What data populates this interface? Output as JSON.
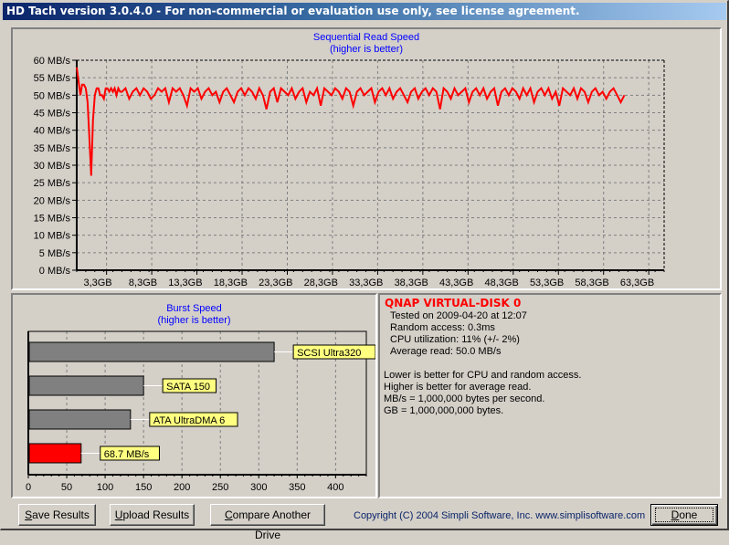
{
  "window": {
    "title": "HD Tach version 3.0.4.0  - For non-commercial or evaluation use only, see license agreement."
  },
  "sequential_chart": {
    "title_line1": "Sequential Read Speed",
    "title_line2": "(higher is better)"
  },
  "burst_chart": {
    "title_line1": "Burst Speed",
    "title_line2": "(higher is better)"
  },
  "info": {
    "drive_name": "QNAP VIRTUAL-DISK 0",
    "tested_on": "Tested on 2009-04-20 at 12:07",
    "random_access": "Random access: 0.3ms",
    "cpu_utilization": "CPU utilization: 11% (+/- 2%)",
    "average_read": "Average read: 50.0 MB/s",
    "notes": [
      "Lower is better for CPU and random access.",
      "Higher is better for average read.",
      "MB/s = 1,000,000 bytes per second.",
      "GB = 1,000,000,000 bytes."
    ]
  },
  "buttons": {
    "save_results": {
      "accel": "S",
      "rest": "ave Results"
    },
    "upload_results": {
      "accel": "U",
      "rest": "pload Results"
    },
    "compare_drive": {
      "accel": "C",
      "rest": "ompare Another Drive"
    },
    "done": {
      "accel": "D",
      "rest": "one"
    }
  },
  "footer": {
    "copyright": "Copyright (C) 2004 Simpli Software, Inc. www.simplisoftware.com"
  },
  "colors": {
    "line": "#ff0000",
    "reference_bar": "#808080",
    "tested_bar": "#ff0000",
    "label_bg": "#ffff80",
    "title_blue": "#0000ff"
  },
  "chart_data": [
    {
      "type": "line",
      "title": "Sequential Read Speed (higher is better)",
      "xlabel": "",
      "ylabel": "",
      "ylim": [
        0,
        60
      ],
      "xlim": [
        0,
        65
      ],
      "y_ticks": [
        "0 MB/s",
        "5 MB/s",
        "10 MB/s",
        "15 MB/s",
        "20 MB/s",
        "25 MB/s",
        "30 MB/s",
        "35 MB/s",
        "40 MB/s",
        "45 MB/s",
        "50 MB/s",
        "55 MB/s",
        "60 MB/s"
      ],
      "x_ticks": [
        "3,3GB",
        "8,3GB",
        "13,3GB",
        "18,3GB",
        "23,3GB",
        "28,3GB",
        "33,3GB",
        "38,3GB",
        "43,3GB",
        "48,3GB",
        "53,3GB",
        "58,3GB",
        "63,3GB"
      ],
      "x_tick_values": [
        3.3,
        8.3,
        13.3,
        18.3,
        23.3,
        28.3,
        33.3,
        38.3,
        43.3,
        48.3,
        53.3,
        58.3,
        63.3
      ],
      "grid": true,
      "series": [
        {
          "name": "Read speed",
          "x": [
            0,
            0.2,
            0.4,
            0.6,
            0.8,
            1.0,
            1.2,
            1.4,
            1.6,
            1.8,
            2.0,
            2.2,
            2.4,
            2.6,
            2.8,
            3.0,
            3.2,
            3.4,
            3.6,
            3.8,
            4.0,
            4.2,
            4.4,
            4.6,
            4.8,
            5.0,
            5.4,
            5.8,
            6.2,
            6.6,
            7.0,
            7.4,
            7.8,
            8.2,
            8.6,
            9.0,
            9.4,
            9.8,
            10.2,
            10.6,
            11.0,
            11.4,
            11.8,
            12.2,
            12.6,
            13.0,
            13.4,
            13.8,
            14.2,
            14.6,
            15.0,
            15.4,
            15.8,
            16.2,
            16.6,
            17.0,
            17.4,
            17.8,
            18.2,
            18.6,
            19.0,
            19.4,
            19.8,
            20.2,
            20.6,
            21.0,
            21.4,
            21.8,
            22.2,
            22.6,
            23.0,
            23.4,
            23.8,
            24.2,
            24.6,
            25.0,
            25.4,
            25.8,
            26.2,
            26.6,
            27.0,
            27.4,
            27.8,
            28.2,
            28.6,
            29.0,
            29.4,
            29.8,
            30.2,
            30.6,
            31.0,
            31.4,
            31.8,
            32.2,
            32.6,
            33.0,
            33.4,
            33.8,
            34.2,
            34.6,
            35.0,
            35.4,
            35.8,
            36.2,
            36.6,
            37.0,
            37.4,
            37.8,
            38.2,
            38.6,
            39.0,
            39.4,
            39.8,
            40.2,
            40.6,
            41.0,
            41.4,
            41.8,
            42.2,
            42.6,
            43.0,
            43.4,
            43.8,
            44.2,
            44.6,
            45.0,
            45.4,
            45.8,
            46.2,
            46.6,
            47.0,
            47.4,
            47.8,
            48.2,
            48.6,
            49.0,
            49.4,
            49.8,
            50.2,
            50.6,
            51.0,
            51.4,
            51.8,
            52.2,
            52.6,
            53.0,
            53.4,
            53.8,
            54.2,
            54.6,
            55.0,
            55.4,
            55.8,
            56.2,
            56.6,
            57.0,
            57.4,
            57.8,
            58.2,
            58.6,
            59.0,
            59.4,
            59.8,
            60.2,
            60.6,
            61.0,
            61.4,
            61.8,
            62.2,
            62.6,
            63.0,
            63.4,
            63.8,
            64.2,
            64.6,
            65.0
          ],
          "y": [
            58,
            54,
            50,
            53,
            53,
            52,
            48,
            38,
            27,
            43,
            50,
            52,
            52,
            50,
            50,
            49,
            52,
            52,
            51,
            52,
            51,
            52,
            50,
            52,
            51,
            51,
            52,
            49,
            51,
            52,
            50,
            52,
            51,
            49,
            50,
            52,
            51,
            52,
            48,
            52,
            51,
            52,
            50,
            47,
            52,
            51,
            52,
            49,
            51,
            52,
            50,
            51,
            48,
            51,
            52,
            50,
            48,
            51,
            52,
            50,
            52,
            51,
            49,
            52,
            50,
            46,
            51,
            52,
            48,
            52,
            51,
            50,
            52,
            49,
            51,
            52,
            48,
            51,
            50,
            52,
            47,
            52,
            51,
            50,
            52,
            51,
            49,
            52,
            51,
            47,
            51,
            52,
            50,
            51,
            52,
            48,
            51,
            52,
            50,
            52,
            49,
            51,
            52,
            50,
            48,
            51,
            52,
            49,
            51,
            52,
            50,
            52,
            51,
            46,
            52,
            51,
            49,
            52,
            50,
            51,
            52,
            48,
            51,
            52,
            50,
            52,
            49,
            51,
            52,
            47,
            51,
            52,
            50,
            52,
            51,
            49,
            52,
            50,
            52,
            48,
            51,
            52,
            50,
            52,
            49,
            51,
            47,
            52,
            51,
            50,
            52,
            49,
            52,
            51,
            48,
            51,
            52,
            50,
            51,
            49,
            51,
            52,
            50,
            48,
            50
          ]
        }
      ]
    },
    {
      "type": "bar",
      "title": "Burst Speed (higher is better)",
      "orientation": "horizontal",
      "xlim": [
        0,
        440
      ],
      "x_ticks": [
        0,
        50,
        100,
        150,
        200,
        250,
        300,
        350,
        400
      ],
      "grid": true,
      "categories": [
        "SCSI Ultra320",
        "SATA 150",
        "ATA UltraDMA 6",
        "68.7 MB/s"
      ],
      "values": [
        320,
        150,
        133,
        68.7
      ],
      "bar_kinds": [
        "reference",
        "reference",
        "reference",
        "tested"
      ]
    }
  ]
}
